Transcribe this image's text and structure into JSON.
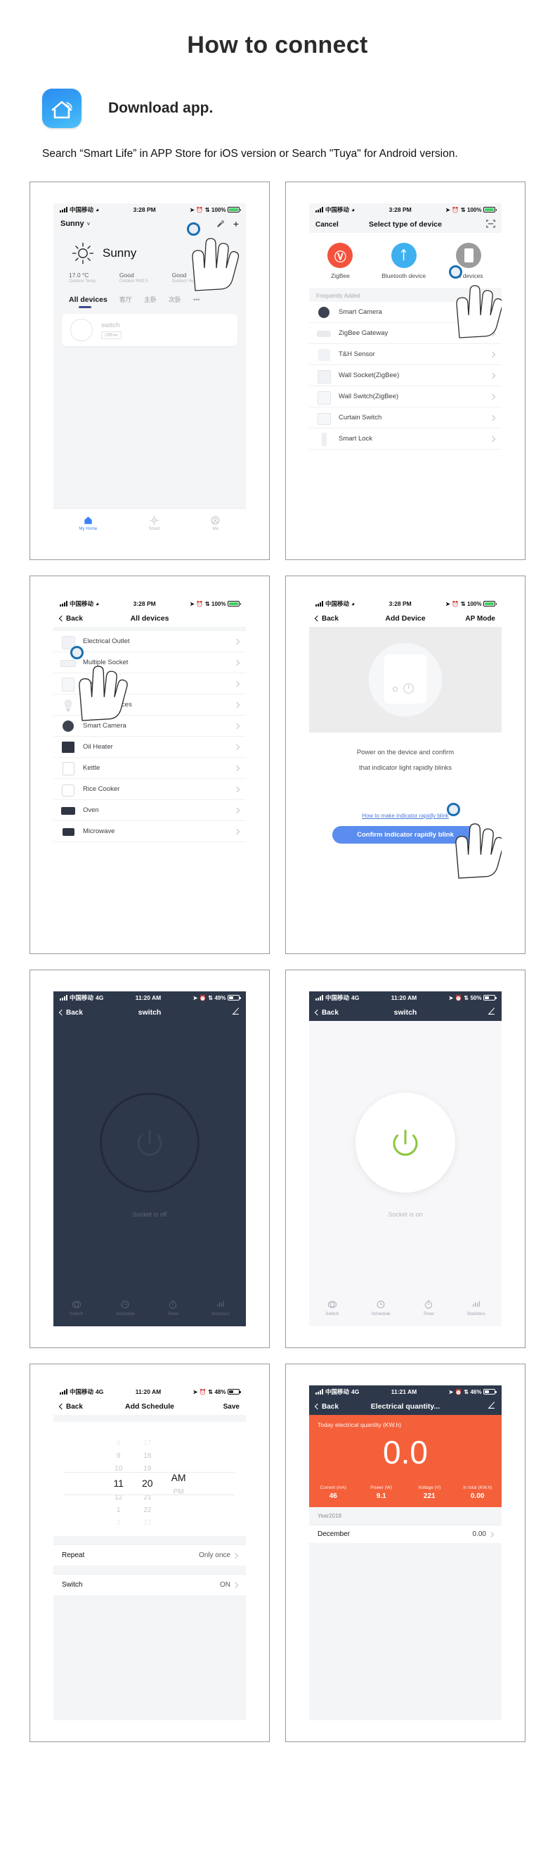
{
  "header": {
    "title": "How to connect",
    "download_label": "Download  app.",
    "app_icon": "smart-life-house-icon",
    "description": "Search “Smart Life” in APP Store for iOS version or Search \"Tuya\" for Android version."
  },
  "colors": {
    "accent_blue": "#3b82f6",
    "button_blue": "#5b8def",
    "zigbee_red": "#f4523d",
    "bluetooth_blue": "#3fb0ef",
    "alldevices_gray": "#9b9b9b",
    "dark_navy": "#2e384b",
    "energy_orange": "#f4603a",
    "power_green": "#8cc63e"
  },
  "panel1": {
    "name": "home-screen",
    "status": {
      "carrier": "中国移动",
      "wifi": "wifi-icon",
      "time": "3:28 PM",
      "battery_pct": "100%"
    },
    "city": "Sunny",
    "city_chevron": "chevron-down-icon",
    "mic_icon": "mic-icon",
    "plus_icon": "plus-icon",
    "weather_icon": "sun-icon",
    "weather_text": "Sunny",
    "stats": [
      {
        "value": "17.0 °C",
        "label": "Outdoor Temp"
      },
      {
        "value": "Good",
        "label": "Outdoor PM2.5"
      },
      {
        "value": "Good",
        "label": "Outdoor Hu."
      }
    ],
    "tabs": [
      "All devices",
      "客厅",
      "主卧",
      "次卧",
      "•••"
    ],
    "active_tab": "All devices",
    "device_card": {
      "name": "switch",
      "status": "Offline",
      "icon": "socket-icon"
    },
    "bottom_tabs": [
      {
        "label": "My Home",
        "icon": "home-icon",
        "active": true
      },
      {
        "label": "Smart",
        "icon": "smart-icon",
        "active": false
      },
      {
        "label": "Me",
        "icon": "profile-icon",
        "active": false
      }
    ]
  },
  "panel2": {
    "name": "select-device-type",
    "status": {
      "carrier": "中国移动",
      "time": "3:28 PM",
      "battery_pct": "100%"
    },
    "nav": {
      "left": "Cancel",
      "title": "Select type of device",
      "right_icon": "scan-icon"
    },
    "types": [
      {
        "label": "ZigBee",
        "icon": "zigbee-icon",
        "color": "#f4523d"
      },
      {
        "label": "Bluetooth device",
        "icon": "bluetooth-icon",
        "color": "#3fb0ef"
      },
      {
        "label": "All devices",
        "icon": "all-devices-icon",
        "color": "#9b9b9b"
      }
    ],
    "section": "Frequently Added",
    "items": [
      "Smart Camera",
      "ZigBee Gateway",
      "T&H Sensor",
      "Wall Socket(ZigBee)",
      "Wall Switch(ZigBee)",
      "Curtain Switch",
      "Smart Lock"
    ],
    "tap_target": "All devices"
  },
  "panel3": {
    "name": "all-devices-list",
    "status": {
      "carrier": "中国移动",
      "time": "3:28 PM",
      "battery_pct": "100%"
    },
    "nav": {
      "left": "Back",
      "title": "All devices"
    },
    "items": [
      "Electrical Outlet",
      "Multiple Socket",
      "Switch",
      "Lighting Devices",
      "Smart Camera",
      "Oil Heater",
      "Kettle",
      "Rice Cooker",
      "Oven",
      "Microwave"
    ],
    "tap_target": "Electrical Outlet"
  },
  "panel4": {
    "name": "add-device-ap-mode",
    "status": {
      "carrier": "中国移动",
      "time": "3:28 PM",
      "battery_pct": "100%"
    },
    "nav": {
      "left": "Back",
      "title": "Add Device",
      "right": "AP Mode"
    },
    "instruction_line1": "Power on the device and confirm",
    "instruction_line2": "that indicator light rapidly blinks",
    "link": "How to make indicator rapidly blink",
    "button": "Confirm indicator rapidly blink",
    "device_image": "smart-socket-illustration"
  },
  "panel5": {
    "name": "switch-off-screen",
    "status": {
      "carrier": "中国移动",
      "network": "4G",
      "time": "11:20 AM",
      "battery_pct": "49%"
    },
    "nav": {
      "left": "Back",
      "title": "switch",
      "right_icon": "edit-pencil-icon"
    },
    "power_icon": "power-button-icon",
    "state_text": "Socket is off",
    "tabs": [
      {
        "label": "Switch",
        "icon": "switch-icon"
      },
      {
        "label": "Schedule",
        "icon": "clock-icon"
      },
      {
        "label": "Timer",
        "icon": "timer-icon"
      },
      {
        "label": "Statistics",
        "icon": "bar-chart-icon"
      }
    ]
  },
  "panel6": {
    "name": "switch-on-screen",
    "status": {
      "carrier": "中国移动",
      "network": "4G",
      "time": "11:20 AM",
      "battery_pct": "50%"
    },
    "nav": {
      "left": "Back",
      "title": "switch",
      "right_icon": "edit-pencil-icon"
    },
    "power_icon": "power-button-icon",
    "state_text": "Socket is on",
    "tabs": [
      {
        "label": "Switch",
        "icon": "switch-icon"
      },
      {
        "label": "Schedule",
        "icon": "clock-icon"
      },
      {
        "label": "Timer",
        "icon": "timer-icon"
      },
      {
        "label": "Statistics",
        "icon": "bar-chart-icon"
      }
    ]
  },
  "panel7": {
    "name": "add-schedule-screen",
    "status": {
      "carrier": "中国移动",
      "network": "4G",
      "time": "11:20 AM",
      "battery_pct": "48%"
    },
    "nav": {
      "left": "Back",
      "title": "Add Schedule",
      "right": "Save"
    },
    "picker": {
      "hours": [
        "8",
        "9",
        "10",
        "11",
        "12",
        "1",
        "2"
      ],
      "minutes": [
        "17",
        "18",
        "19",
        "20",
        "21",
        "22",
        "23"
      ],
      "meridiem": [
        "AM",
        "PM"
      ],
      "selected_hour": "11",
      "selected_minute": "20",
      "selected_meridiem": "AM"
    },
    "rows": [
      {
        "label": "Repeat",
        "value": "Only once"
      },
      {
        "label": "Switch",
        "value": "ON"
      }
    ]
  },
  "panel8": {
    "name": "electrical-quantity-screen",
    "status": {
      "carrier": "中国移动",
      "network": "4G",
      "time": "11:21 AM",
      "battery_pct": "46%"
    },
    "nav": {
      "left": "Back",
      "title": "Electrical quantity...",
      "right_icon": "edit-pencil-icon"
    },
    "card_caption": "Today electrical quantity (KW.h)",
    "card_value": "0.0",
    "metrics": [
      {
        "label": "Current  (mA)",
        "value": "46"
      },
      {
        "label": "Power (W)",
        "value": "9.1"
      },
      {
        "label": "Voltage (V)",
        "value": "221"
      },
      {
        "label": "In total (KW.h)",
        "value": "0.00"
      }
    ],
    "year_label": "Year2018",
    "rows": [
      {
        "label": "December",
        "value": "0.00"
      }
    ]
  }
}
